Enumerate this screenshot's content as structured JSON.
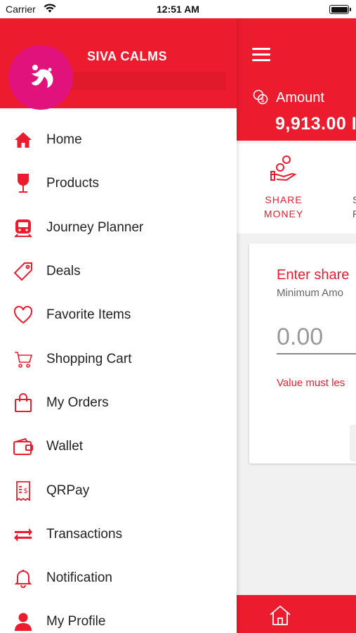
{
  "status_bar": {
    "carrier": "Carrier",
    "time": "12:51 AM"
  },
  "drawer": {
    "user_name": "SIVA CALMS",
    "menu": [
      {
        "label": "Home",
        "icon": "home-icon"
      },
      {
        "label": "Products",
        "icon": "wine-glass-icon"
      },
      {
        "label": "Journey Planner",
        "icon": "train-icon"
      },
      {
        "label": "Deals",
        "icon": "tag-icon"
      },
      {
        "label": "Favorite Items",
        "icon": "heart-icon"
      },
      {
        "label": "Shopping Cart",
        "icon": "cart-icon"
      },
      {
        "label": "My Orders",
        "icon": "shopping-bag-icon"
      },
      {
        "label": "Wallet",
        "icon": "wallet-icon"
      },
      {
        "label": "QRPay",
        "icon": "receipt-icon"
      },
      {
        "label": "Transactions",
        "icon": "transfer-arrows-icon"
      },
      {
        "label": "Notification",
        "icon": "bell-icon"
      },
      {
        "label": "My Profile",
        "icon": "person-icon"
      }
    ]
  },
  "main": {
    "amount_label": "Amount",
    "amount_value": "9,913.00 I",
    "share_money_line1": "SHARE",
    "share_money_line2": "MONEY",
    "second_action_line1": "S",
    "second_action_line2": "P",
    "card_title": "Enter share",
    "card_subtitle": "Minimum Amo",
    "amount_placeholder": "0.00",
    "error_text": "Value must les"
  },
  "colors": {
    "accent": "#ec1c2e",
    "avatar": "#e1127b",
    "background": "#f1f1f1"
  }
}
